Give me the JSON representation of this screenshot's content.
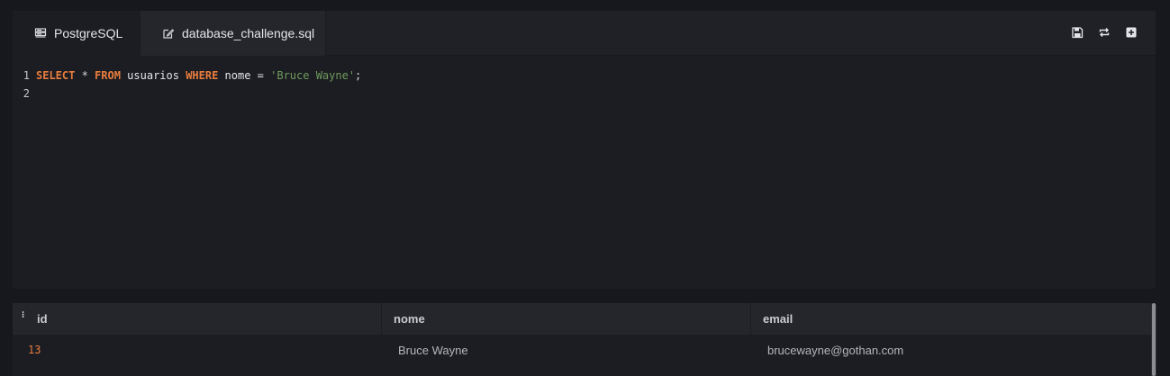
{
  "tabs": [
    {
      "label": "PostgreSQL",
      "icon": "server-icon"
    },
    {
      "label": "database_challenge.sql",
      "icon": "edit-icon"
    }
  ],
  "actions": [
    {
      "name": "save",
      "icon": "save-icon"
    },
    {
      "name": "reset",
      "icon": "reload-icon"
    },
    {
      "name": "add",
      "icon": "plus-square-icon"
    }
  ],
  "editor": {
    "lines": [
      {
        "number": "1",
        "tokens": [
          {
            "text": "SELECT",
            "type": "keyword"
          },
          {
            "text": " * ",
            "type": "operator"
          },
          {
            "text": "FROM",
            "type": "keyword"
          },
          {
            "text": " usuarios ",
            "type": "identifier"
          },
          {
            "text": "WHERE",
            "type": "keyword"
          },
          {
            "text": " nome = ",
            "type": "identifier"
          },
          {
            "text": "'Bruce Wayne'",
            "type": "string"
          },
          {
            "text": ";",
            "type": "operator"
          }
        ]
      },
      {
        "number": "2",
        "tokens": []
      }
    ]
  },
  "results": {
    "sort_indicator": "⁝",
    "columns": [
      "id",
      "nome",
      "email"
    ],
    "rows": [
      {
        "id": "13",
        "nome": "Bruce Wayne",
        "email": "brucewayne@gothan.com"
      }
    ]
  },
  "colors": {
    "background": "#17181d",
    "panel": "#1c1d22",
    "keyword": "#e87d3e",
    "string": "#6f9a5c",
    "id_value": "#e87d3e"
  }
}
